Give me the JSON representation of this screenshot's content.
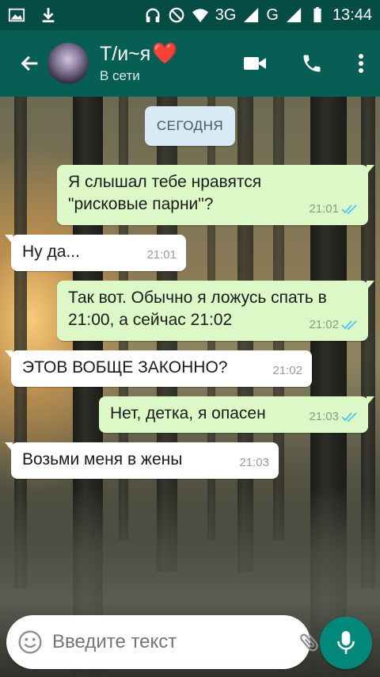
{
  "status_bar": {
    "time": "13:44",
    "network_label": "3G",
    "network_label_2": "G",
    "icons": [
      "gallery-icon",
      "download-icon",
      "headset-icon",
      "dnd-icon",
      "wifi-icon",
      "signal-icon",
      "battery-icon"
    ]
  },
  "header": {
    "contact_name": "Т/и~я",
    "contact_emoji": "❤️",
    "contact_status": "В сети",
    "icons": [
      "back-arrow-icon",
      "video-call-icon",
      "phone-icon",
      "more-vert-icon"
    ]
  },
  "chat": {
    "date_chip": "СЕГОДНЯ",
    "messages": [
      {
        "direction": "out",
        "text": "Я слышал тебе нравятся \"рисковые парни\"?",
        "time": "21:01",
        "read": true
      },
      {
        "direction": "in",
        "text": "Ну да...",
        "time": "21:01"
      },
      {
        "direction": "out",
        "text": "Так вот. Обычно я ложусь спать в 21:00, а сейчас 21:02",
        "time": "21:02",
        "read": true
      },
      {
        "direction": "in",
        "text": "ЭТОВ ВОБЩЕ ЗАКОННО?",
        "time": "21:02"
      },
      {
        "direction": "out",
        "text": "Нет, детка, я опасен",
        "time": "21:03",
        "read": true
      },
      {
        "direction": "in",
        "text": "Возьми меня в жены",
        "time": "21:03"
      }
    ]
  },
  "composer": {
    "placeholder": "Введите текст",
    "icons": [
      "emoji-icon",
      "paperclip-icon",
      "camera-icon",
      "mic-icon"
    ]
  },
  "colors": {
    "header": "#075e54",
    "status_bar": "#054d44",
    "outgoing_bubble": "#dcf8c6",
    "incoming_bubble": "#ffffff",
    "read_tick": "#4fc3f7",
    "mic_button": "#00897b"
  }
}
